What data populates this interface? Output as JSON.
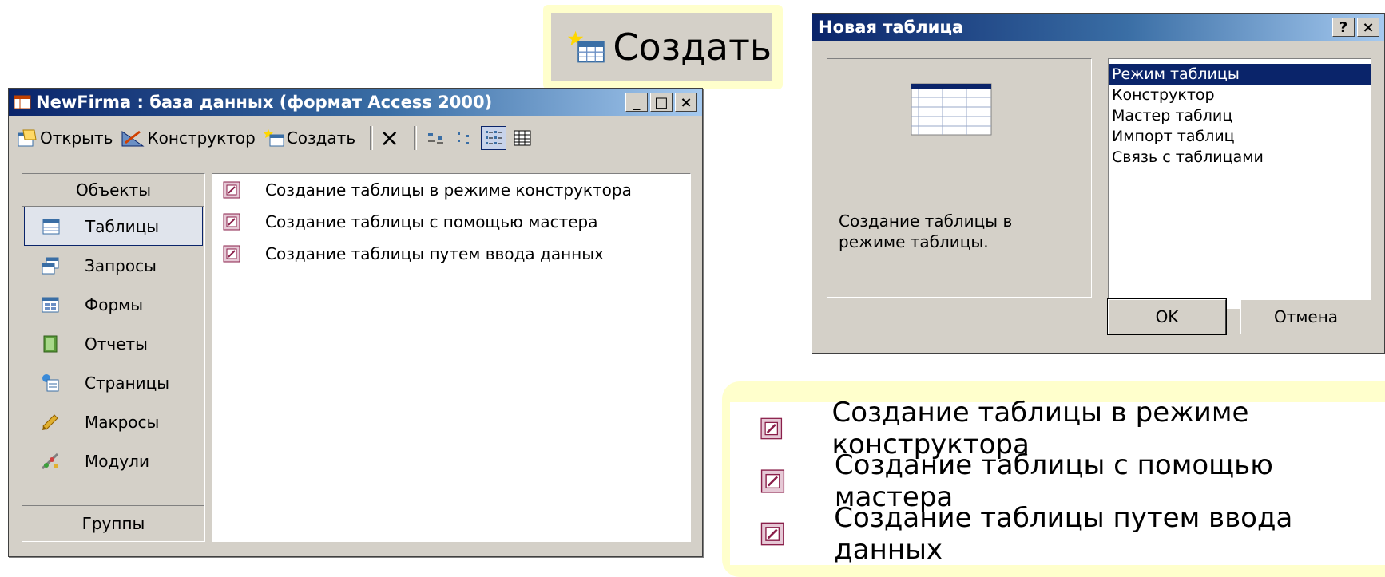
{
  "db_window": {
    "title": "NewFirma : база данных (формат Access 2000)",
    "controls": {
      "minimize": "_",
      "maximize": "□",
      "close": "×"
    },
    "toolbar": {
      "open": "Открыть",
      "design": "Конструктор",
      "create": "Создать",
      "delete_icon": "×"
    },
    "objects_header": "Объекты",
    "objects": [
      {
        "label": "Таблицы",
        "icon": "table-icon",
        "selected": true
      },
      {
        "label": "Запросы",
        "icon": "query-icon"
      },
      {
        "label": "Формы",
        "icon": "form-icon"
      },
      {
        "label": "Отчеты",
        "icon": "report-icon"
      },
      {
        "label": "Страницы",
        "icon": "page-icon"
      },
      {
        "label": "Макросы",
        "icon": "macro-icon"
      },
      {
        "label": "Модули",
        "icon": "module-icon"
      }
    ],
    "groups_label": "Группы",
    "list_items": [
      "Создание таблицы в режиме конструктора",
      "Создание таблицы с помощью мастера",
      "Создание таблицы путем ввода данных"
    ]
  },
  "create_callout": {
    "label": "Создать"
  },
  "new_table_dialog": {
    "title": "Новая таблица",
    "controls": {
      "help": "?",
      "close": "×"
    },
    "description": "Создание таблицы в режиме таблицы.",
    "modes": [
      "Режим таблицы",
      "Конструктор",
      "Мастер таблиц",
      "Импорт таблиц",
      "Связь с таблицами"
    ],
    "selected_mode": "Режим таблицы",
    "ok_label": "OK",
    "cancel_label": "Отмена"
  },
  "list_callout": {
    "items": [
      "Создание таблицы в режиме конструктора",
      "Создание таблицы с помощью мастера",
      "Создание таблицы путем ввода данных"
    ]
  },
  "colors": {
    "titlebar": "#0a246a",
    "window_bg": "#d4d0c8",
    "callout_bg": "#ffffcc",
    "selection": "#0a246a"
  }
}
